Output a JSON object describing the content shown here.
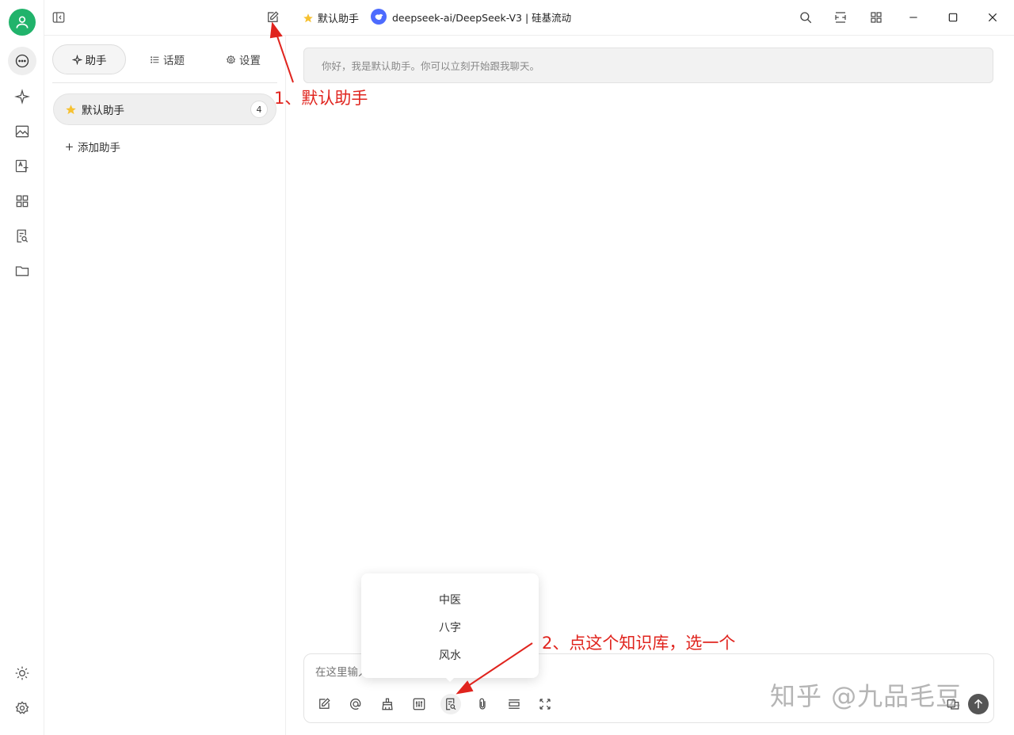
{
  "colors": {
    "accent_green": "#21b36b",
    "annotation_red": "#e0241e",
    "star_yellow": "#f6c131",
    "model_blue": "#4d6bfe"
  },
  "rail": {
    "avatar_icon": "user-icon",
    "items": [
      {
        "icon": "chat-icon",
        "active": true
      },
      {
        "icon": "sparkle-icon"
      },
      {
        "icon": "image-icon"
      },
      {
        "icon": "translate-icon"
      },
      {
        "icon": "apps-icon"
      },
      {
        "icon": "knowledge-icon"
      },
      {
        "icon": "folder-icon"
      }
    ],
    "bottom": [
      {
        "icon": "theme-icon"
      },
      {
        "icon": "settings-icon"
      }
    ]
  },
  "topbar": {
    "assistant_name": "默认助手",
    "model_label": "deepseek-ai/DeepSeek-V3 | 硅基流动"
  },
  "panel": {
    "tabs": [
      {
        "label": "助手",
        "icon": "sparkle-icon",
        "active": true
      },
      {
        "label": "话题",
        "icon": "list-icon"
      },
      {
        "label": "设置",
        "icon": "gear-icon"
      }
    ],
    "assistant": {
      "name": "默认助手",
      "count": "4"
    },
    "add_label": "添加助手"
  },
  "main": {
    "welcome": "你好，我是默认助手。你可以立刻开始跟我聊天。",
    "composer_placeholder": "在这里输入消息..."
  },
  "popup": {
    "items": [
      "中医",
      "八字",
      "风水"
    ]
  },
  "annotations": {
    "a1": "1、默认助手",
    "a2": "2、点这个知识库，选一个"
  },
  "watermark": "知乎 @九品毛豆"
}
